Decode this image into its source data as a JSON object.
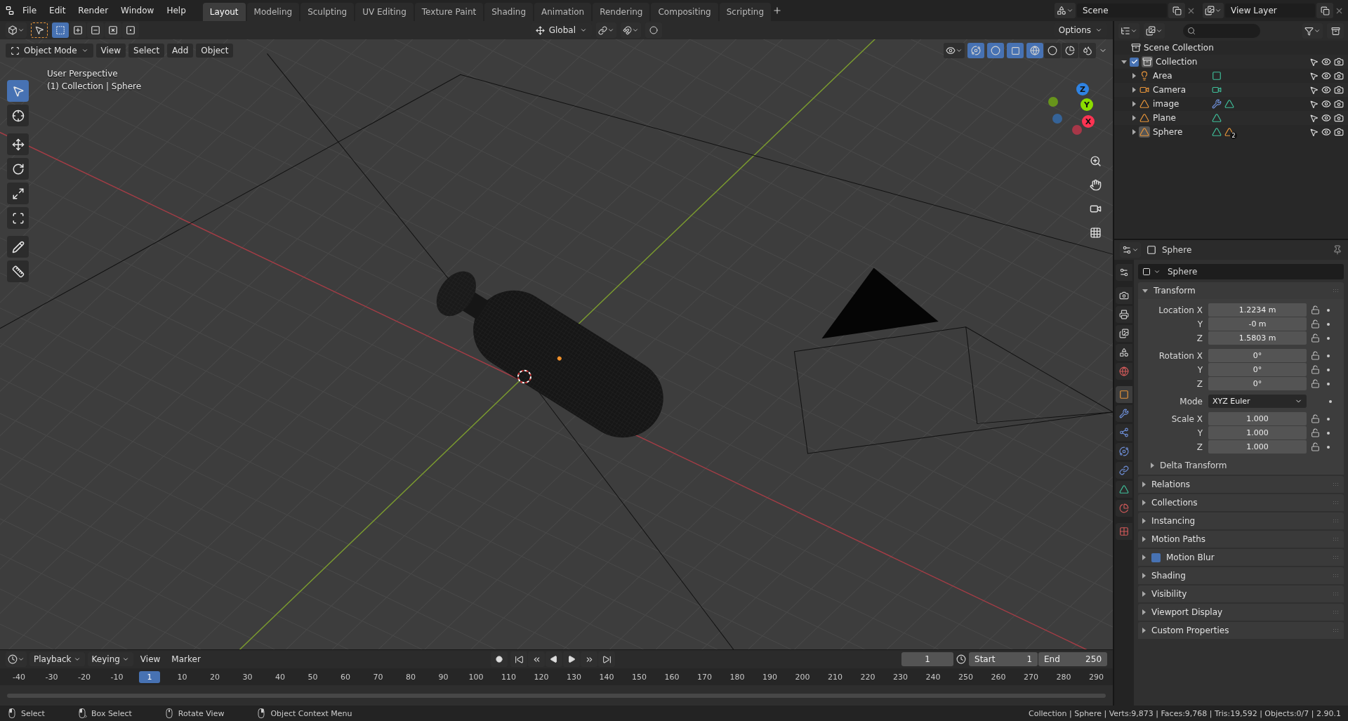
{
  "top_menu": [
    "File",
    "Edit",
    "Render",
    "Window",
    "Help"
  ],
  "workspaces": [
    {
      "label": "Layout",
      "selected": true
    },
    {
      "label": "Modeling",
      "selected": false
    },
    {
      "label": "Sculpting",
      "selected": false
    },
    {
      "label": "UV Editing",
      "selected": false
    },
    {
      "label": "Texture Paint",
      "selected": false
    },
    {
      "label": "Shading",
      "selected": false
    },
    {
      "label": "Animation",
      "selected": false
    },
    {
      "label": "Rendering",
      "selected": false
    },
    {
      "label": "Compositing",
      "selected": false
    },
    {
      "label": "Scripting",
      "selected": false
    }
  ],
  "scene": "Scene",
  "view_layer": "View Layer",
  "tool_header": {
    "select_modes": [
      {
        "kind": "new",
        "selected": true
      },
      {
        "kind": "extend",
        "selected": false
      },
      {
        "kind": "subtract",
        "selected": false
      },
      {
        "kind": "invert",
        "selected": false
      },
      {
        "kind": "intersect",
        "selected": false
      }
    ],
    "orientation": "Global",
    "options": "Options"
  },
  "viewport_header": {
    "mode": "Object Mode",
    "menus": [
      "View",
      "Select",
      "Add",
      "Object"
    ],
    "shading": [
      {
        "kind": "wireframe",
        "selected": true
      },
      {
        "kind": "solid",
        "selected": false
      },
      {
        "kind": "material",
        "selected": false
      },
      {
        "kind": "rendered",
        "selected": false
      }
    ]
  },
  "viewport": {
    "view_name": "User Perspective",
    "context": "(1) Collection | Sphere"
  },
  "tools": [
    {
      "kind": "select",
      "selected": true
    },
    {
      "kind": "cursor",
      "selected": false
    },
    {
      "kind": "move",
      "selected": false
    },
    {
      "kind": "rotate",
      "selected": false
    },
    {
      "kind": "scale",
      "selected": false
    },
    {
      "kind": "transform",
      "selected": false
    },
    {
      "kind": "annotate",
      "selected": false
    },
    {
      "kind": "measure",
      "selected": false
    }
  ],
  "gizmo": [
    {
      "label": "Z",
      "color": "#2f83e3"
    },
    {
      "label": "Y",
      "color": "#8bdc00"
    },
    {
      "label": "X",
      "color": "#ff3352"
    }
  ],
  "outliner": {
    "root": "Scene Collection",
    "items": [
      {
        "name": "Collection",
        "kind": "collection",
        "checked": true,
        "expanded": true,
        "active": true,
        "children": [
          {
            "name": "Area",
            "kind": "light",
            "expanded": false,
            "active": false,
            "data": [
              {
                "kind": "light-data"
              }
            ]
          },
          {
            "name": "Camera",
            "kind": "camera",
            "expanded": false,
            "active": false,
            "data": [
              {
                "kind": "camera-data"
              }
            ]
          },
          {
            "name": "image",
            "kind": "mesh",
            "expanded": false,
            "active": false,
            "data": [
              {
                "kind": "modifier"
              },
              {
                "kind": "mesh-data"
              }
            ]
          },
          {
            "name": "Plane",
            "kind": "mesh",
            "expanded": false,
            "active": false,
            "data": [
              {
                "kind": "mesh-data"
              }
            ]
          },
          {
            "name": "Sphere",
            "kind": "mesh",
            "expanded": false,
            "active": true,
            "data": [
              {
                "kind": "mesh-data"
              },
              {
                "kind": "children",
                "badge": "2"
              }
            ]
          }
        ]
      }
    ]
  },
  "properties": {
    "object": "Sphere",
    "datablock": "Sphere",
    "tabs": [
      {
        "kind": "tool",
        "selected": false
      },
      {
        "kind": "render",
        "selected": false
      },
      {
        "kind": "output",
        "selected": false
      },
      {
        "kind": "view-layer",
        "selected": false
      },
      {
        "kind": "scene",
        "selected": false
      },
      {
        "kind": "world",
        "selected": false
      },
      {
        "kind": "object",
        "selected": true
      },
      {
        "kind": "modifiers",
        "selected": false
      },
      {
        "kind": "particles",
        "selected": false
      },
      {
        "kind": "physics",
        "selected": false
      },
      {
        "kind": "constraints",
        "selected": false
      },
      {
        "kind": "data",
        "selected": false
      },
      {
        "kind": "material",
        "selected": false
      },
      {
        "kind": "texture",
        "selected": false
      }
    ],
    "transform": {
      "title": "Transform",
      "expanded": true,
      "groups": [
        [
          {
            "kind": "number",
            "label": "Location X",
            "value": "1.2234 m"
          },
          {
            "kind": "number",
            "label": "Y",
            "value": "-0 m"
          },
          {
            "kind": "number",
            "label": "Z",
            "value": "1.5803 m"
          }
        ],
        [
          {
            "kind": "number",
            "label": "Rotation X",
            "value": "0°"
          },
          {
            "kind": "number",
            "label": "Y",
            "value": "0°"
          },
          {
            "kind": "number",
            "label": "Z",
            "value": "0°"
          }
        ],
        [
          {
            "kind": "dropdown",
            "label": "Mode",
            "value": "XYZ Euler"
          }
        ],
        [
          {
            "kind": "number",
            "label": "Scale X",
            "value": "1.000"
          },
          {
            "kind": "number",
            "label": "Y",
            "value": "1.000"
          },
          {
            "kind": "number",
            "label": "Z",
            "value": "1.000"
          }
        ]
      ],
      "subpanels": [
        {
          "title": "Delta Transform",
          "expanded": false
        }
      ]
    },
    "panels": [
      {
        "title": "Relations",
        "expanded": false
      },
      {
        "title": "Collections",
        "expanded": false
      },
      {
        "title": "Instancing",
        "expanded": false
      },
      {
        "title": "Motion Paths",
        "expanded": false
      },
      {
        "title": "Motion Blur",
        "expanded": false,
        "checked": true
      },
      {
        "title": "Shading",
        "expanded": false
      },
      {
        "title": "Visibility",
        "expanded": false
      },
      {
        "title": "Viewport Display",
        "expanded": false
      },
      {
        "title": "Custom Properties",
        "expanded": false
      }
    ]
  },
  "timeline": {
    "menus": [
      {
        "label": "Playback",
        "kind": "dropdown"
      },
      {
        "label": "Keying",
        "kind": "dropdown"
      },
      {
        "label": "View",
        "kind": "menu"
      },
      {
        "label": "Marker",
        "kind": "menu"
      }
    ],
    "current_frame": "1",
    "start_label": "Start",
    "start": "1",
    "end_label": "End",
    "end": "250",
    "ruler": [
      {
        "label": "-40",
        "selected": false
      },
      {
        "label": "-30",
        "selected": false
      },
      {
        "label": "-20",
        "selected": false
      },
      {
        "label": "-10",
        "selected": false
      },
      {
        "label": "1",
        "selected": true
      },
      {
        "label": "10",
        "selected": false
      },
      {
        "label": "20",
        "selected": false
      },
      {
        "label": "30",
        "selected": false
      },
      {
        "label": "40",
        "selected": false
      },
      {
        "label": "50",
        "selected": false
      },
      {
        "label": "60",
        "selected": false
      },
      {
        "label": "70",
        "selected": false
      },
      {
        "label": "80",
        "selected": false
      },
      {
        "label": "90",
        "selected": false
      },
      {
        "label": "100",
        "selected": false
      },
      {
        "label": "110",
        "selected": false
      },
      {
        "label": "120",
        "selected": false
      },
      {
        "label": "130",
        "selected": false
      },
      {
        "label": "140",
        "selected": false
      },
      {
        "label": "150",
        "selected": false
      },
      {
        "label": "160",
        "selected": false
      },
      {
        "label": "170",
        "selected": false
      },
      {
        "label": "180",
        "selected": false
      },
      {
        "label": "190",
        "selected": false
      },
      {
        "label": "200",
        "selected": false
      },
      {
        "label": "210",
        "selected": false
      },
      {
        "label": "220",
        "selected": false
      },
      {
        "label": "230",
        "selected": false
      },
      {
        "label": "240",
        "selected": false
      },
      {
        "label": "250",
        "selected": false
      },
      {
        "label": "260",
        "selected": false
      },
      {
        "label": "270",
        "selected": false
      },
      {
        "label": "280",
        "selected": false
      },
      {
        "label": "290",
        "selected": false
      }
    ]
  },
  "status_bar": {
    "hints": [
      {
        "kind": "mouse-left",
        "label": "Select"
      },
      {
        "kind": "mouse-drag",
        "label": "Box Select"
      },
      {
        "kind": "mouse-middle",
        "label": "Rotate View"
      },
      {
        "kind": "mouse-right",
        "label": "Object Context Menu"
      }
    ],
    "stats": "Collection | Sphere | Verts:9,873 | Faces:9,768 | Tris:19,592 | Objects:0/7 | 2.90.1"
  }
}
